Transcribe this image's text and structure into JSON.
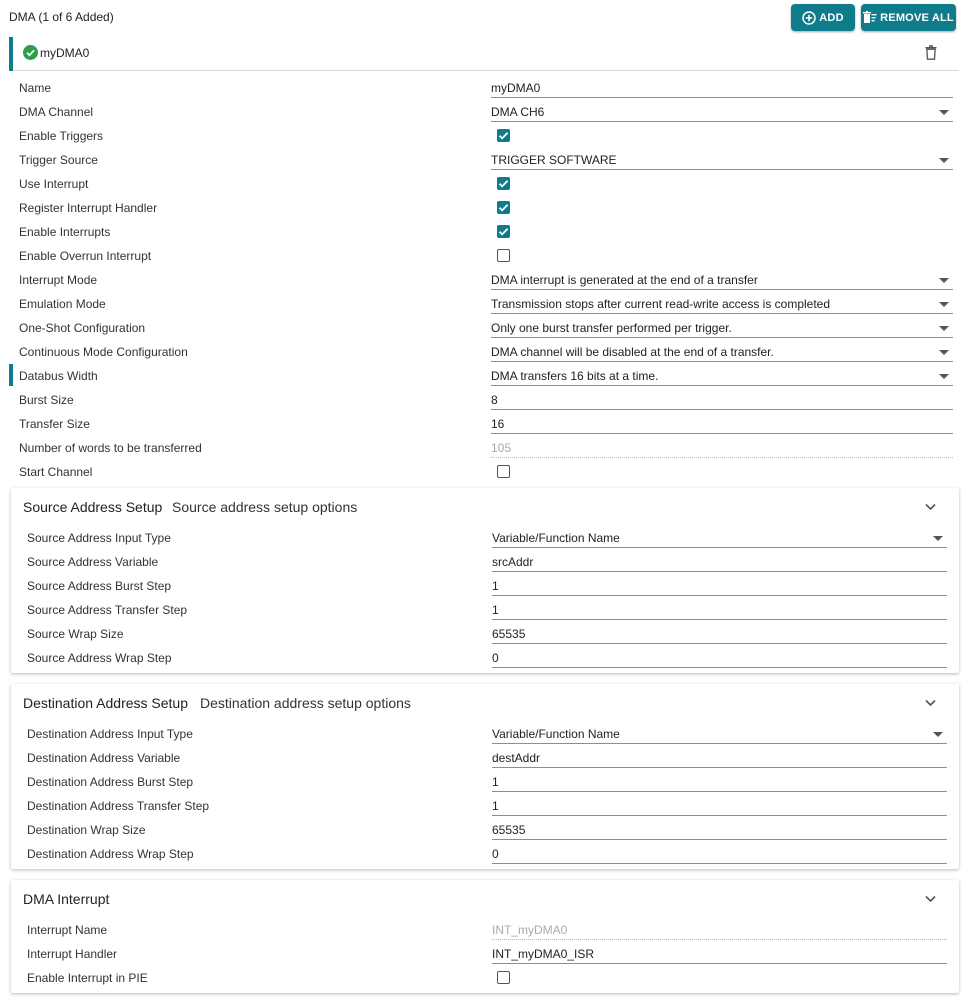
{
  "header": {
    "title": "DMA (1 of 6 Added)",
    "add_label": "ADD",
    "remove_all_label": "REMOVE ALL"
  },
  "instance": {
    "name": "myDMA0"
  },
  "colors": {
    "accent": "#0f7c8c",
    "success": "#2aa04a"
  },
  "config": {
    "name": {
      "label": "Name",
      "value": "myDMA0"
    },
    "dma_channel": {
      "label": "DMA Channel",
      "value": "DMA CH6"
    },
    "enable_triggers": {
      "label": "Enable Triggers",
      "checked": true
    },
    "trigger_source": {
      "label": "Trigger Source",
      "value": "TRIGGER SOFTWARE"
    },
    "use_interrupt": {
      "label": "Use Interrupt",
      "checked": true
    },
    "register_interrupt_handler": {
      "label": "Register Interrupt Handler",
      "checked": true
    },
    "enable_interrupts": {
      "label": "Enable Interrupts",
      "checked": true
    },
    "enable_overrun_interrupt": {
      "label": "Enable Overrun Interrupt",
      "checked": false
    },
    "interrupt_mode": {
      "label": "Interrupt Mode",
      "value": "DMA interrupt is generated at the end of a transfer"
    },
    "emulation_mode": {
      "label": "Emulation Mode",
      "value": "Transmission stops after current read-write access is completed"
    },
    "one_shot": {
      "label": "One-Shot Configuration",
      "value": "Only one burst transfer performed per trigger."
    },
    "continuous_mode": {
      "label": "Continuous Mode Configuration",
      "value": "DMA channel will be disabled at the end of a transfer."
    },
    "databus_width": {
      "label": "Databus Width",
      "value": "DMA transfers 16 bits at a time."
    },
    "burst_size": {
      "label": "Burst Size",
      "value": "8"
    },
    "transfer_size": {
      "label": "Transfer Size",
      "value": "16"
    },
    "num_words": {
      "label": "Number of words to be transferred",
      "value": "105"
    },
    "start_channel": {
      "label": "Start Channel",
      "checked": false
    }
  },
  "source": {
    "title": "Source Address Setup",
    "description": "Source address setup options",
    "input_type": {
      "label": "Source Address Input Type",
      "value": "Variable/Function Name"
    },
    "variable": {
      "label": "Source Address Variable",
      "value": "srcAddr"
    },
    "burst_step": {
      "label": "Source Address Burst Step",
      "value": "1"
    },
    "transfer_step": {
      "label": "Source Address Transfer Step",
      "value": "1"
    },
    "wrap_size": {
      "label": "Source Wrap Size",
      "value": "65535"
    },
    "wrap_step": {
      "label": "Source Address Wrap Step",
      "value": "0"
    }
  },
  "destination": {
    "title": "Destination Address Setup",
    "description": "Destination address setup options",
    "input_type": {
      "label": "Destination Address Input Type",
      "value": "Variable/Function Name"
    },
    "variable": {
      "label": "Destination Address Variable",
      "value": "destAddr"
    },
    "burst_step": {
      "label": "Destination Address Burst Step",
      "value": "1"
    },
    "transfer_step": {
      "label": "Destination Address Transfer Step",
      "value": "1"
    },
    "wrap_size": {
      "label": "Destination Wrap Size",
      "value": "65535"
    },
    "wrap_step": {
      "label": "Destination Address Wrap Step",
      "value": "0"
    }
  },
  "interrupt": {
    "title": "DMA Interrupt",
    "name": {
      "label": "Interrupt Name",
      "value": "INT_myDMA0"
    },
    "handler": {
      "label": "Interrupt Handler",
      "value": "INT_myDMA0_ISR"
    },
    "enable_pie": {
      "label": "Enable Interrupt in PIE",
      "checked": false
    }
  }
}
